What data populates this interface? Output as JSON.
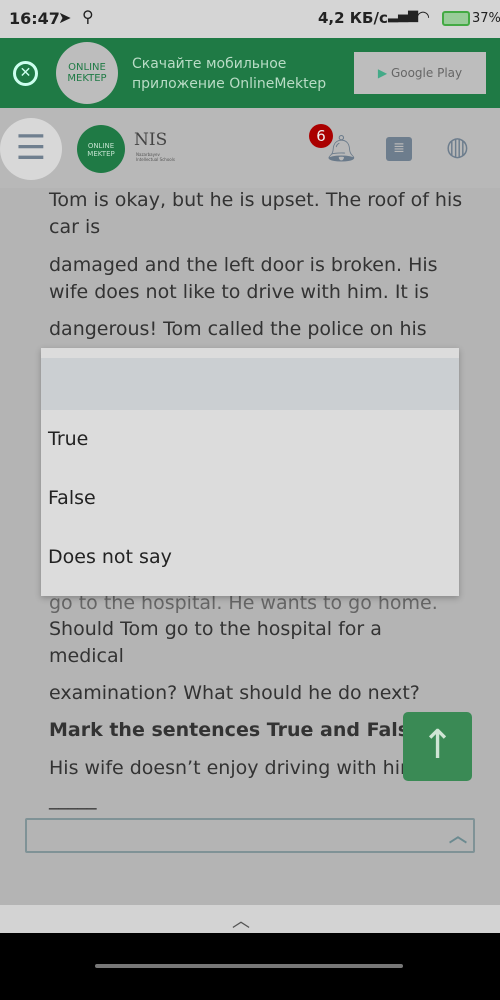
{
  "status_bar": {
    "time": "16:47",
    "speed": "4,2 КБ/с",
    "battery": "37%"
  },
  "banner": {
    "logo_text": "ONLINE MEKTEP",
    "message_line1": "Скачайте мобильное",
    "message_line2": "приложение OnlineMektep",
    "store_button": "Google Play"
  },
  "nav": {
    "logo_text": "ONLINE MEKTEP",
    "nis_logo": "NIS",
    "nis_subtitle": "Nazarbayev Intellectual Schools",
    "notification_count": "6"
  },
  "content": {
    "lines": [
      "Tom is okay, but he is upset. The roof of his",
      "car is",
      "damaged and the left door is broken. His",
      "wife does not like to drive with him. It is",
      "dangerous! Tom called the police on his",
      "go to the hospital. He wants to go home.",
      "Should Tom go to the hospital for a",
      "medical",
      "examination? What should he do next?"
    ],
    "instruction": "Mark the sentences True and False.",
    "question": "His wife doesn’t enjoy driving with him",
    "blank": "_____"
  },
  "dropdown": {
    "selected": "",
    "options": [
      "True",
      "False",
      "Does not say"
    ]
  },
  "accent_color": "#1f7a45"
}
